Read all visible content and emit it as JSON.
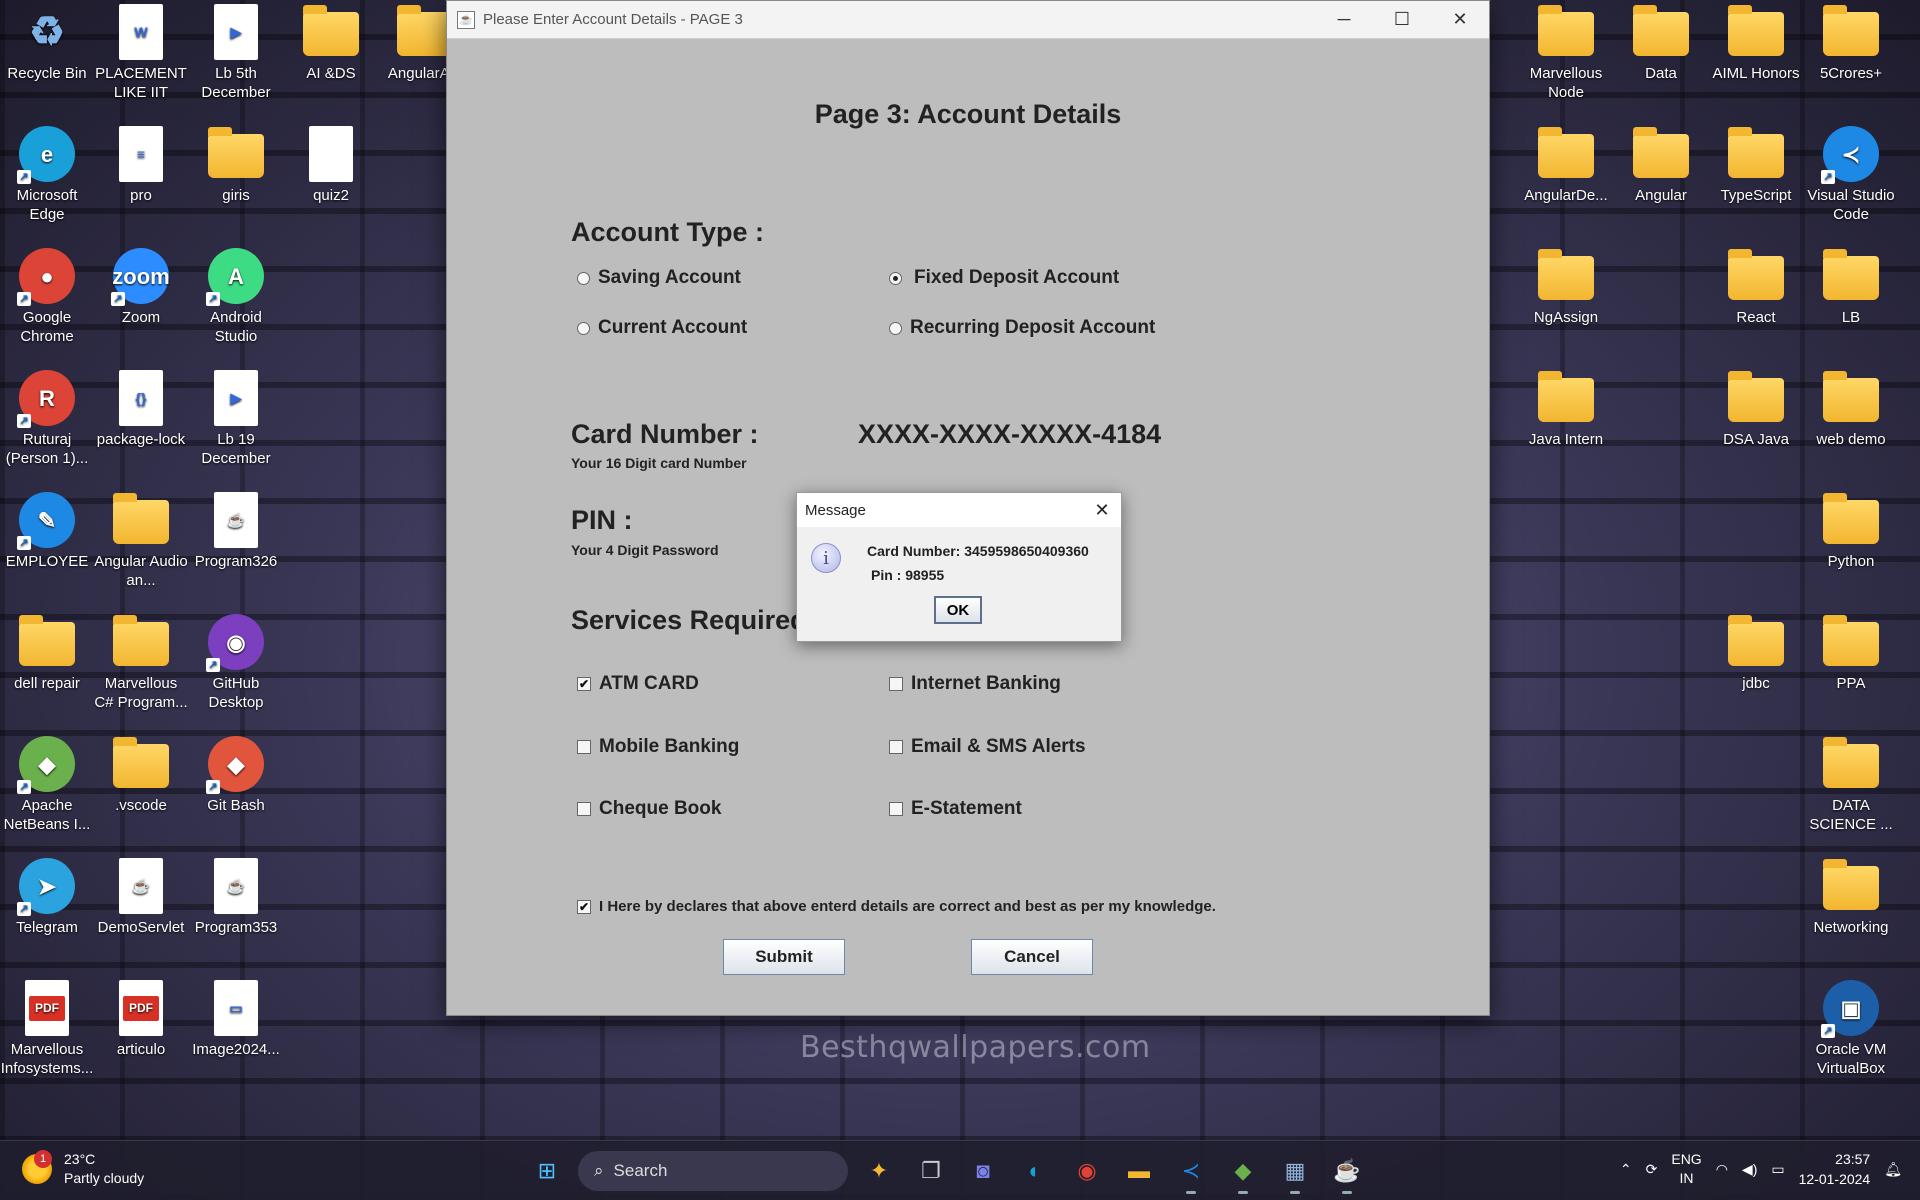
{
  "desktop": {
    "left_icons": [
      {
        "label": "Recycle Bin",
        "icon": "recycle-bin-icon",
        "kind": "bin",
        "glyph": "♻",
        "color": "#7fb3e6"
      },
      {
        "label": "PLACEMENT LIKE IIT",
        "icon": "word-doc-icon",
        "kind": "doc",
        "glyph": "W",
        "color": ""
      },
      {
        "label": "Lb 5th December",
        "icon": "media-file-icon",
        "kind": "doc",
        "glyph": "▶",
        "color": ""
      },
      {
        "label": "AI &DS",
        "icon": "folder-icon",
        "kind": "folder",
        "glyph": "",
        "color": ""
      },
      {
        "label": "AngularA...",
        "icon": "folder-icon",
        "kind": "folder",
        "glyph": "",
        "color": ""
      },
      {
        "label": "Microsoft Edge",
        "icon": "edge-icon",
        "kind": "round",
        "glyph": "e",
        "color": "#1aa0d8"
      },
      {
        "label": "pro",
        "icon": "document-icon",
        "kind": "doc",
        "glyph": "≡",
        "color": ""
      },
      {
        "label": "giris",
        "icon": "folder-icon",
        "kind": "folder",
        "glyph": "",
        "color": ""
      },
      {
        "label": "quiz2",
        "icon": "blank-file-icon",
        "kind": "doc",
        "glyph": "",
        "color": ""
      },
      {
        "label": "Google Chrome",
        "icon": "chrome-icon",
        "kind": "round",
        "glyph": "●",
        "color": "#db4437"
      },
      {
        "label": "Zoom",
        "icon": "zoom-icon",
        "kind": "round",
        "glyph": "zoom",
        "color": "#2d8cff"
      },
      {
        "label": "Android Studio",
        "icon": "android-studio-icon",
        "kind": "round",
        "glyph": "A",
        "color": "#3ddc84"
      },
      {
        "label": "Ruturaj (Person 1)...",
        "icon": "chrome-profile-icon",
        "kind": "round",
        "glyph": "R",
        "color": "#db4437"
      },
      {
        "label": "package-lock",
        "icon": "json-file-icon",
        "kind": "doc",
        "glyph": "{}",
        "color": ""
      },
      {
        "label": "Lb 19 December",
        "icon": "media-file-icon",
        "kind": "doc",
        "glyph": "▶",
        "color": ""
      },
      {
        "label": "EMPLOYEE",
        "icon": "tool-icon",
        "kind": "round",
        "glyph": "✎",
        "color": "#1e88e5"
      },
      {
        "label": "Angular Audio an...",
        "icon": "folder-icon",
        "kind": "folder",
        "glyph": "",
        "color": ""
      },
      {
        "label": "Program326",
        "icon": "java-file-icon",
        "kind": "doc",
        "glyph": "☕",
        "color": ""
      },
      {
        "label": "dell repair",
        "icon": "folder-icon",
        "kind": "folder",
        "glyph": "",
        "color": ""
      },
      {
        "label": "Marvellous C# Program...",
        "icon": "folder-icon",
        "kind": "folder",
        "glyph": "",
        "color": ""
      },
      {
        "label": "GitHub Desktop",
        "icon": "github-icon",
        "kind": "round",
        "glyph": "◉",
        "color": "#7b3fbf"
      },
      {
        "label": "Apache NetBeans I...",
        "icon": "netbeans-icon",
        "kind": "round",
        "glyph": "◆",
        "color": "#6ab04c"
      },
      {
        "label": ".vscode",
        "icon": "folder-icon",
        "kind": "folder",
        "glyph": "",
        "color": ""
      },
      {
        "label": "Git Bash",
        "icon": "git-bash-icon",
        "kind": "round",
        "glyph": "◆",
        "color": "#e0553b"
      },
      {
        "label": "Telegram",
        "icon": "telegram-icon",
        "kind": "round",
        "glyph": "➤",
        "color": "#2aa3df"
      },
      {
        "label": "DemoServlet",
        "icon": "java-file-icon",
        "kind": "doc",
        "glyph": "☕",
        "color": ""
      },
      {
        "label": "Program353",
        "icon": "java-file-icon",
        "kind": "doc",
        "glyph": "☕",
        "color": ""
      },
      {
        "label": "Marvellous Infosystems...",
        "icon": "pdf-icon",
        "kind": "pdf",
        "glyph": "PDF",
        "color": ""
      },
      {
        "label": "articulo",
        "icon": "pdf-icon",
        "kind": "pdf",
        "glyph": "PDF",
        "color": ""
      },
      {
        "label": "Image2024...",
        "icon": "image-file-icon",
        "kind": "doc",
        "glyph": "▭",
        "color": ""
      }
    ],
    "right_icons": [
      {
        "label": "Marvellous Node",
        "icon": "folder-icon",
        "kind": "folder",
        "glyph": "",
        "color": ""
      },
      {
        "label": "Data",
        "icon": "folder-icon",
        "kind": "folder",
        "glyph": "",
        "color": ""
      },
      {
        "label": "AIML Honors",
        "icon": "folder-icon",
        "kind": "folder",
        "glyph": "",
        "color": ""
      },
      {
        "label": "5Crores+",
        "icon": "folder-icon",
        "kind": "folder",
        "glyph": "",
        "color": ""
      },
      {
        "label": "AngularDe...",
        "icon": "folder-icon",
        "kind": "folder",
        "glyph": "",
        "color": ""
      },
      {
        "label": "Angular",
        "icon": "folder-icon",
        "kind": "folder",
        "glyph": "",
        "color": ""
      },
      {
        "label": "TypeScript",
        "icon": "folder-icon",
        "kind": "folder",
        "glyph": "",
        "color": ""
      },
      {
        "label": "Visual Studio Code",
        "icon": "vscode-icon",
        "kind": "round",
        "glyph": "≺",
        "color": "#1e88e5"
      },
      {
        "label": "NgAssign",
        "icon": "folder-icon",
        "kind": "folder",
        "glyph": "",
        "color": ""
      },
      {
        "label": "React",
        "icon": "folder-icon",
        "kind": "folder",
        "glyph": "",
        "color": ""
      },
      {
        "label": "LB",
        "icon": "folder-icon",
        "kind": "folder",
        "glyph": "",
        "color": ""
      },
      {
        "label": "Java Intern",
        "icon": "folder-icon",
        "kind": "folder",
        "glyph": "",
        "color": ""
      },
      {
        "label": "DSA Java",
        "icon": "folder-icon",
        "kind": "folder",
        "glyph": "",
        "color": ""
      },
      {
        "label": "web demo",
        "icon": "folder-icon",
        "kind": "folder",
        "glyph": "",
        "color": ""
      },
      {
        "label": "Python",
        "icon": "folder-icon",
        "kind": "folder",
        "glyph": "",
        "color": ""
      },
      {
        "label": "jdbc",
        "icon": "folder-icon",
        "kind": "folder",
        "glyph": "",
        "color": ""
      },
      {
        "label": "PPA",
        "icon": "folder-icon",
        "kind": "folder",
        "glyph": "",
        "color": ""
      },
      {
        "label": "DATA SCIENCE ...",
        "icon": "folder-icon",
        "kind": "folder",
        "glyph": "",
        "color": ""
      },
      {
        "label": "Networking",
        "icon": "folder-icon",
        "kind": "folder",
        "glyph": "",
        "color": ""
      },
      {
        "label": "Oracle VM VirtualBox",
        "icon": "virtualbox-icon",
        "kind": "round",
        "glyph": "▣",
        "color": "#1c5fa8"
      }
    ],
    "watermark": "Besthqwallpapers.com"
  },
  "window": {
    "title": "Please Enter Account Details - PAGE 3",
    "heading": "Page 3: Account Details",
    "account_type": {
      "label": "Account Type :",
      "options": [
        {
          "label": "Saving Account",
          "selected": false
        },
        {
          "label": "Fixed Deposit Account",
          "selected": true
        },
        {
          "label": "Current Account",
          "selected": false
        },
        {
          "label": "Recurring Deposit Account",
          "selected": false
        }
      ]
    },
    "card": {
      "label": "Card Number :",
      "hint": "Your 16 Digit card Number",
      "value": "XXXX-XXXX-XXXX-4184"
    },
    "pin": {
      "label": "PIN :",
      "hint": "Your 4 Digit Password"
    },
    "services": {
      "label": "Services Required :",
      "options": [
        {
          "label": "ATM CARD",
          "checked": true
        },
        {
          "label": "Internet Banking",
          "checked": false
        },
        {
          "label": "Mobile Banking",
          "checked": false
        },
        {
          "label": "Email & SMS Alerts",
          "checked": false
        },
        {
          "label": "Cheque Book",
          "checked": false
        },
        {
          "label": "E-Statement",
          "checked": false
        }
      ]
    },
    "declaration": {
      "label": "I Here by declares that above enterd details are correct and best as per my knowledge.",
      "checked": true
    },
    "submit_label": "Submit",
    "cancel_label": "Cancel"
  },
  "dialog": {
    "title": "Message",
    "line1": "Card Number: 3459598650409360",
    "line2": "Pin : 98955",
    "ok_label": "OK"
  },
  "taskbar": {
    "weather_temp": "23°C",
    "weather_desc": "Partly cloudy",
    "weather_badge": "1",
    "search_placeholder": "Search",
    "lang_top": "ENG",
    "lang_bottom": "IN",
    "time": "23:57",
    "date": "12-01-2024"
  }
}
